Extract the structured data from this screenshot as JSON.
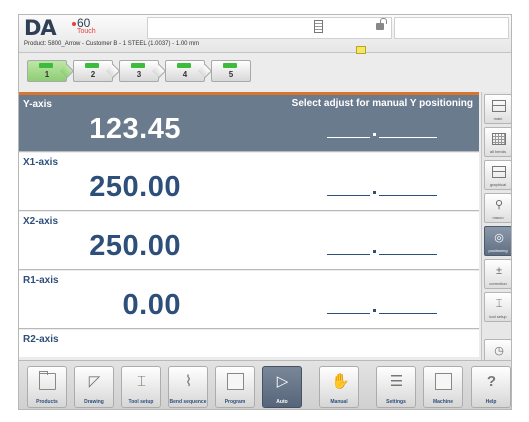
{
  "header": {
    "brand": "DA",
    "version": "60",
    "edition": "Touch",
    "product_line": "Product: 5800_Arrow - Customer B - 1 STEEL (1.0037) - 1.00 mm"
  },
  "steps": [
    "1",
    "2",
    "3",
    "4",
    "5"
  ],
  "axes": [
    {
      "name": "Y-axis",
      "value": "123.45",
      "hint": "Select adjust for manual Y positioning"
    },
    {
      "name": "X1-axis",
      "value": "250.00"
    },
    {
      "name": "X2-axis",
      "value": "250.00"
    },
    {
      "name": "R1-axis",
      "value": "0.00"
    },
    {
      "name": "R2-axis",
      "value": ""
    }
  ],
  "sidebar": [
    {
      "label": "main",
      "icon": "main-view-icon"
    },
    {
      "label": "all bends",
      "icon": "all-bends-icon"
    },
    {
      "label": "graphical",
      "icon": "graphical-icon"
    },
    {
      "label": "macro",
      "icon": "zoom-icon"
    },
    {
      "label": "positioning",
      "icon": "positioning-icon"
    },
    {
      "label": "correction",
      "icon": "correction-icon"
    },
    {
      "label": "tool setup",
      "icon": "tool-setup-icon"
    },
    {
      "label": "diagnostics",
      "icon": "diagnostics-icon"
    }
  ],
  "toolbar": [
    {
      "label": "Products",
      "icon": "folder-icon"
    },
    {
      "label": "Drawing",
      "icon": "drawing-icon"
    },
    {
      "label": "Tool setup",
      "icon": "tool-setup-icon"
    },
    {
      "label": "Bend sequence",
      "icon": "bend-sequence-icon"
    },
    {
      "label": "Program",
      "icon": "program-icon"
    },
    {
      "label": "Auto",
      "icon": "play-icon"
    },
    {
      "label": "Manual",
      "icon": "hand-icon"
    },
    {
      "label": "Settings",
      "icon": "settings-icon"
    },
    {
      "label": "Machine",
      "icon": "machine-icon"
    },
    {
      "label": "Help",
      "icon": "help-icon"
    }
  ]
}
